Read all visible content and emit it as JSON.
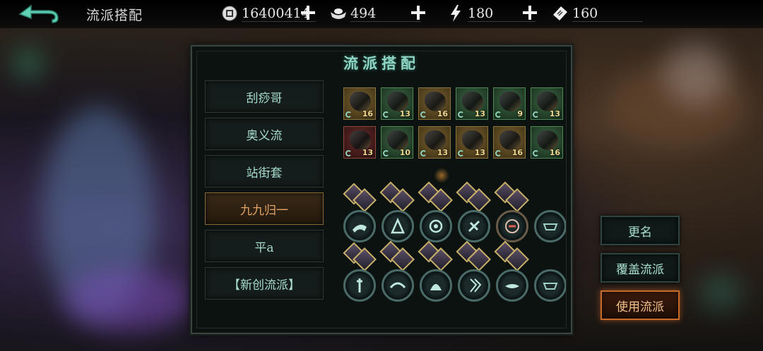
{
  "header": {
    "title": "流派搭配",
    "resources": [
      {
        "icon": "coin-icon",
        "value": "16400414"
      },
      {
        "icon": "silver-ingot-icon",
        "value": "494"
      },
      {
        "icon": "lightning-icon",
        "value": "180"
      },
      {
        "icon": "ticket-icon",
        "value": "160"
      }
    ]
  },
  "panel": {
    "title": "流派搭配",
    "builds": [
      {
        "label": "刮痧哥",
        "active": false
      },
      {
        "label": "奥义流",
        "active": false
      },
      {
        "label": "站街套",
        "active": false
      },
      {
        "label": "九九归一",
        "active": true
      },
      {
        "label": "平a",
        "active": false
      },
      {
        "label": "【新创流派】",
        "active": false
      }
    ],
    "equipment": [
      {
        "level": "16",
        "rarity": "gold"
      },
      {
        "level": "13",
        "rarity": "green"
      },
      {
        "level": "16",
        "rarity": "gold"
      },
      {
        "level": "13",
        "rarity": "green"
      },
      {
        "level": "9",
        "rarity": "green"
      },
      {
        "level": "13",
        "rarity": "green"
      },
      {
        "level": "13",
        "rarity": "red"
      },
      {
        "level": "10",
        "rarity": "green"
      },
      {
        "level": "13",
        "rarity": "gold"
      },
      {
        "level": "13",
        "rarity": "gold"
      },
      {
        "level": "16",
        "rarity": "gold"
      },
      {
        "level": "16",
        "rarity": "green"
      }
    ]
  },
  "actions": {
    "rename": "更名",
    "overwrite": "覆盖流派",
    "use": "使用流派"
  }
}
